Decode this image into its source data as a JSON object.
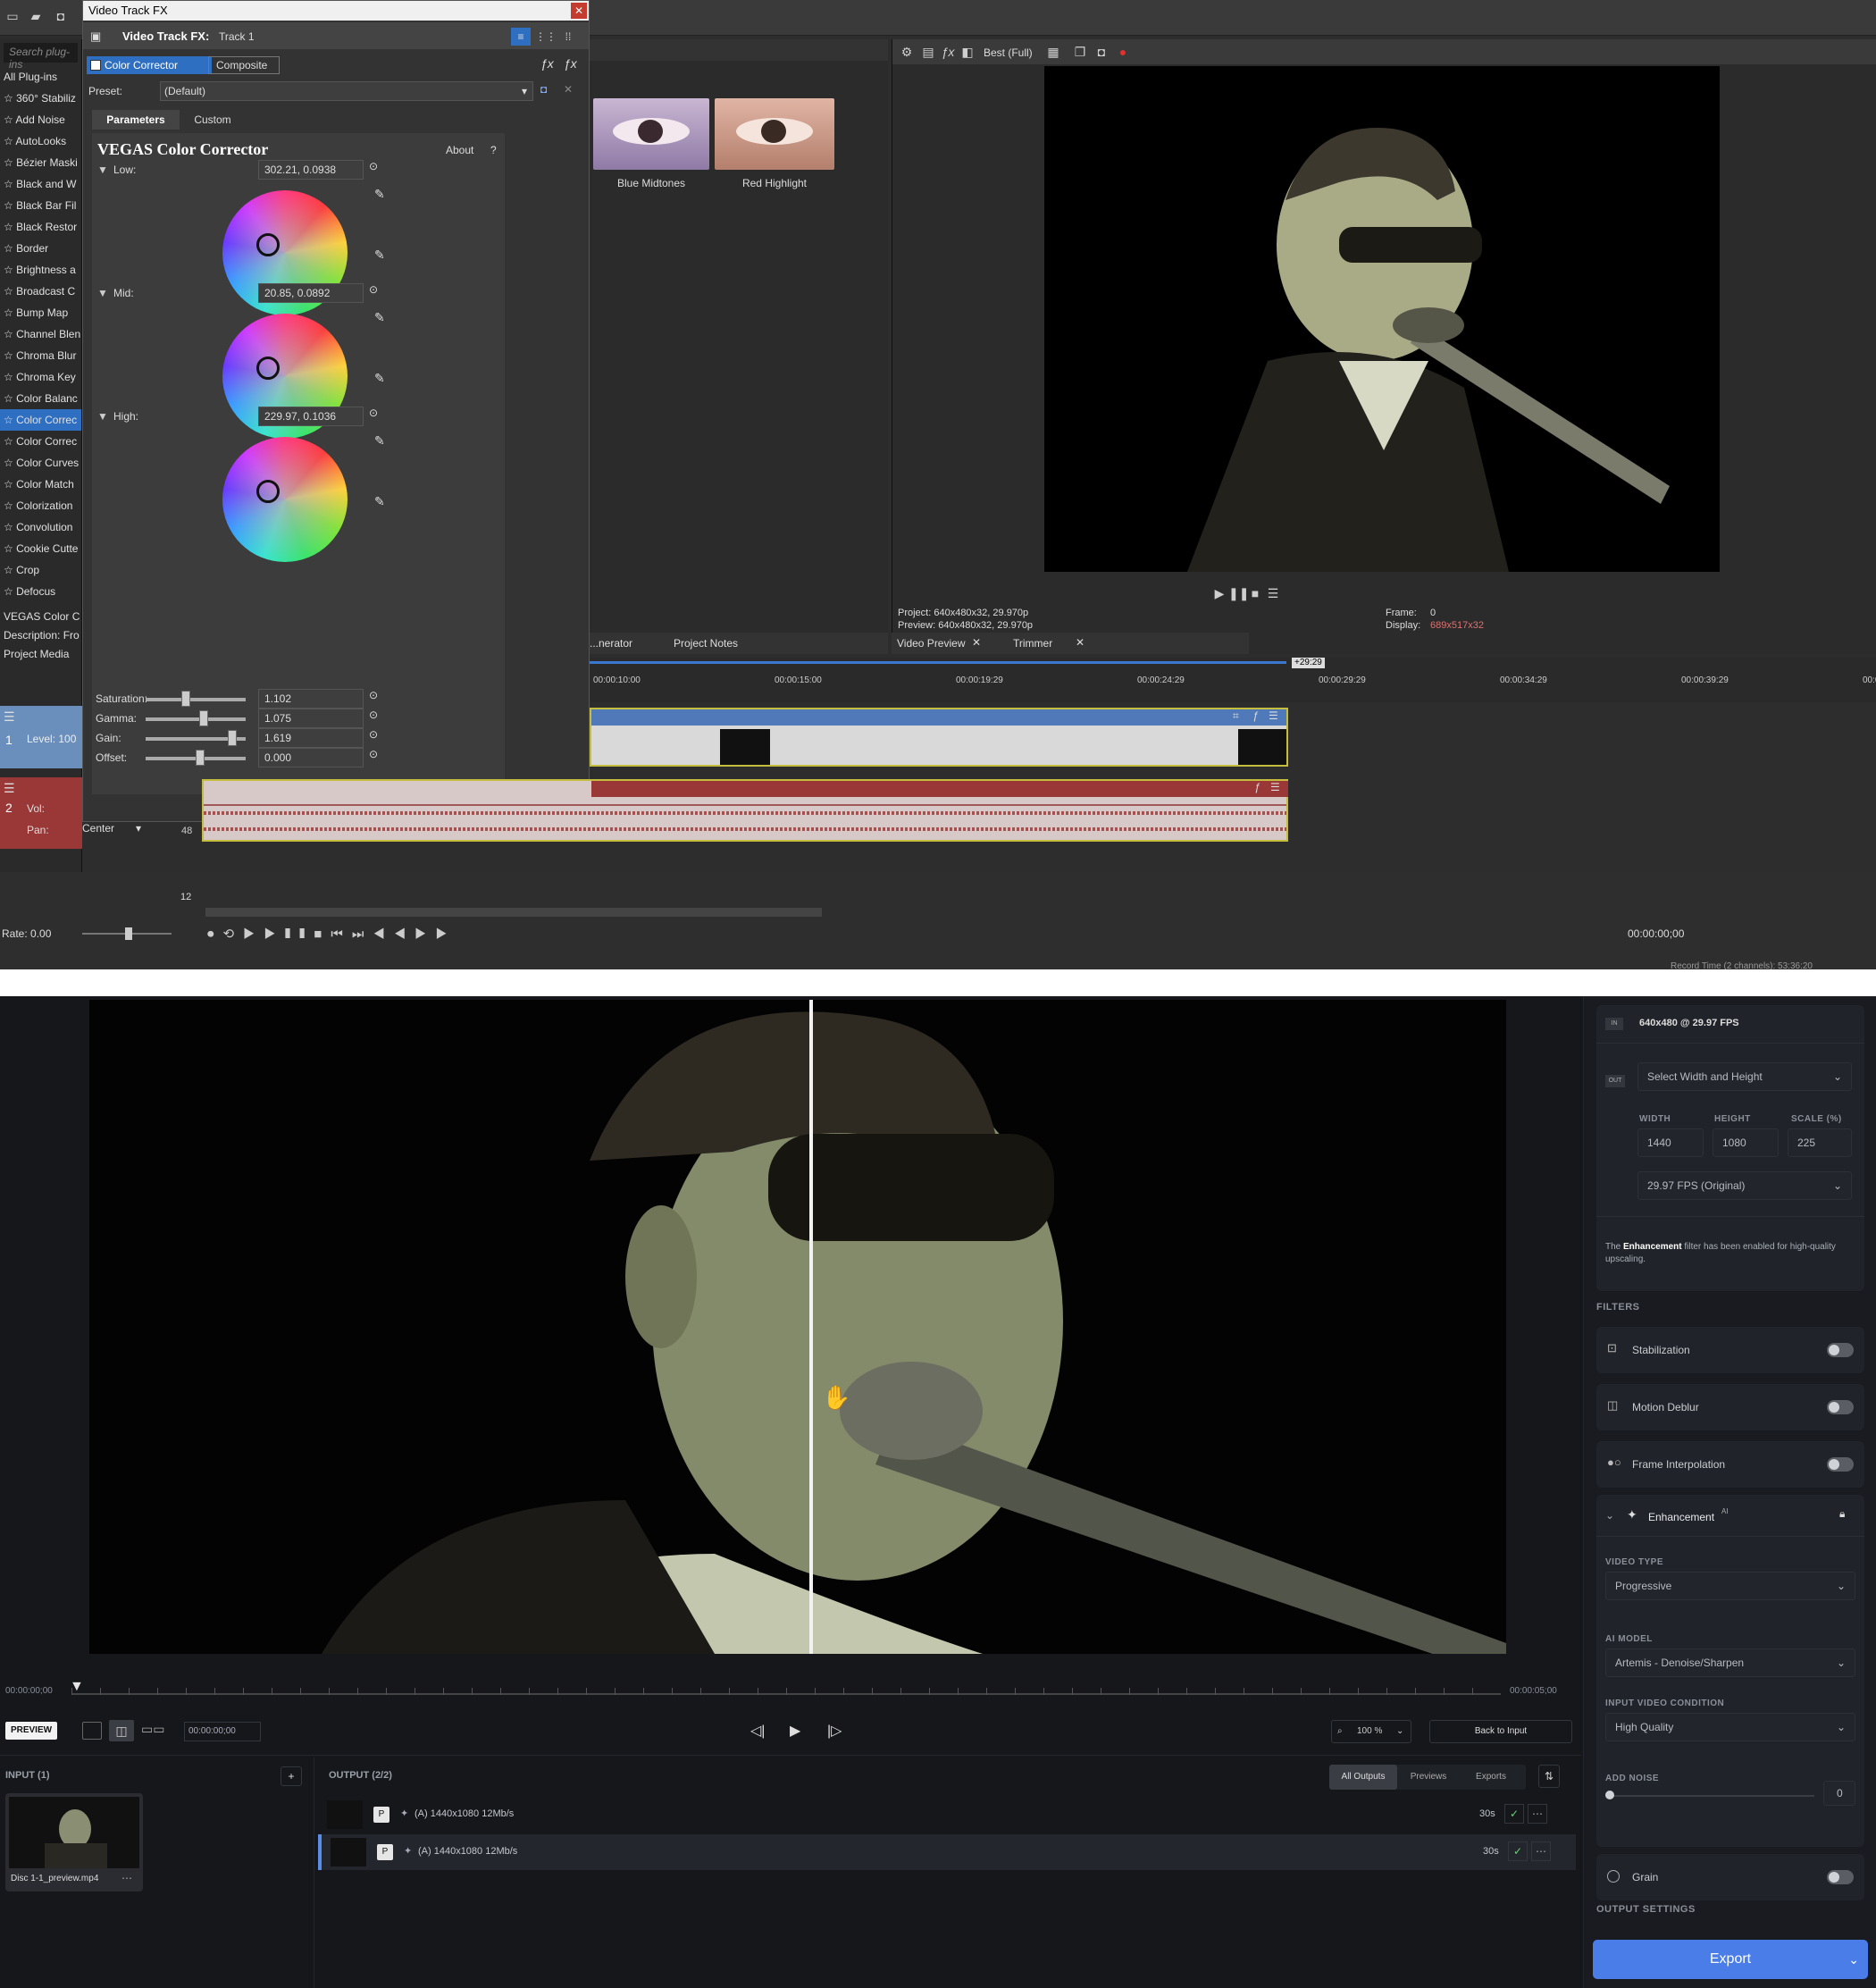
{
  "vegas": {
    "plugin_list": {
      "search_placeholder": "Search plug-ins",
      "items": [
        "All Plug-ins",
        "360° Stabiliz",
        "Add Noise",
        "AutoLooks",
        "Bézier Maski",
        "Black and W",
        "Black Bar Fil",
        "Black Restor",
        "Border",
        "Brightness a",
        "Broadcast C",
        "Bump Map",
        "Channel Blen",
        "Chroma Blur",
        "Chroma Key",
        "Color Balanc",
        "Color Correc",
        "Color Correc",
        "Color Curves",
        "Color Match",
        "Colorization",
        "Convolution",
        "Cookie Cutte",
        "Crop",
        "Defocus"
      ],
      "selected_index": 16,
      "desc_title": "VEGAS Color C",
      "desc_line": "Description: Fro",
      "tab": "Project Media"
    },
    "fx_dialog": {
      "title": "Video Track FX",
      "header": "Video Track FX:",
      "track": "Track 1",
      "chain": [
        "Color Corrector",
        "Composite"
      ],
      "preset_label": "Preset:",
      "preset_value": "(Default)",
      "tabs": [
        "Parameters",
        "Custom"
      ],
      "plugin_name": "VEGAS Color Corrector",
      "about": "About",
      "help": "?",
      "wheels": [
        {
          "label": "Low:",
          "value": "302.21, 0.0938"
        },
        {
          "label": "Mid:",
          "value": "20.85, 0.0892"
        },
        {
          "label": "High:",
          "value": "229.97, 0.1036"
        }
      ],
      "sliders": [
        {
          "label": "Saturation:",
          "value": "1.102",
          "pos": 0.36
        },
        {
          "label": "Gamma:",
          "value": "1.075",
          "pos": 0.54
        },
        {
          "label": "Gain:",
          "value": "1.619",
          "pos": 0.82
        },
        {
          "label": "Offset:",
          "value": "0.000",
          "pos": 0.5
        }
      ]
    },
    "presets": [
      {
        "name": "Blue Midtones"
      },
      {
        "name": "Red Highlight"
      }
    ],
    "preview": {
      "quality": "Best (Full)",
      "project": "Project:  640x480x32, 29.970p",
      "preview": "Preview: 640x480x32, 29.970p",
      "frame_label": "Frame:",
      "frame": "0",
      "display_label": "Display:",
      "display": "689x517x32",
      "tabs": [
        "Video Preview",
        "Trimmer"
      ],
      "left_tabs": [
        "...nerator",
        "Project Notes"
      ]
    },
    "timeline": {
      "ticks": [
        "00:00:10:00",
        "00:00:15:00",
        "00:00:19:29",
        "00:00:24:29",
        "00:00:29:29",
        "00:00:34:29",
        "00:00:39:29",
        "00:00:44:29",
        "00:00:"
      ],
      "end_marker": "+29:29",
      "level": "Level: 100",
      "vol": "Vol:",
      "pan": "Pan:",
      "pan_value": "Center",
      "track_nums": [
        "1",
        "2"
      ],
      "db": "48",
      "rate": "Rate: 0.00",
      "timecode": "00:00:00;00",
      "record": "Record Time (2 channels): 53:36:20",
      "ruler_val": "12"
    }
  },
  "topaz": {
    "timeline": {
      "start": "00:00:00;00",
      "end": "00:00:05;00"
    },
    "bottom": {
      "preview_badge": "PREVIEW",
      "timecode": "00:00:00;00",
      "zoom": "100 %",
      "back": "Back to Input"
    },
    "input": {
      "label": "INPUT (1)",
      "file": "Disc 1-1_preview.mp4"
    },
    "output": {
      "label": "OUTPUT (2/2)",
      "tabs": [
        "All Outputs",
        "Previews",
        "Exports"
      ],
      "rows": [
        {
          "p": "P",
          "spec": "(A)  1440x1080  12Mb/s",
          "dur": "30s"
        },
        {
          "p": "P",
          "spec": "(A)  1440x1080  12Mb/s",
          "dur": "30s"
        }
      ]
    },
    "side": {
      "in_badge": "IN",
      "in_spec": "640x480 @ 29.97 FPS",
      "out_badge": "OUT",
      "size_select": "Select Width and Height",
      "width_label": "WIDTH",
      "height_label": "HEIGHT",
      "scale_label": "SCALE (%)",
      "width": "1440",
      "height": "1080",
      "scale": "225",
      "fps": "29.97 FPS (Original)",
      "note_pre": "The ",
      "note_bold": "Enhancement",
      "note_post": " filter has been enabled for high-quality upscaling.",
      "filters_label": "FILTERS",
      "filters": [
        "Stabilization",
        "Motion Deblur",
        "Frame Interpolation"
      ],
      "ai_sup": "AI",
      "enhancement": "Enhancement",
      "video_type_label": "VIDEO TYPE",
      "video_type": "Progressive",
      "ai_model_label": "AI MODEL",
      "ai_model": "Artemis - Denoise/Sharpen",
      "condition_label": "INPUT VIDEO CONDITION",
      "condition": "High Quality",
      "noise_label": "ADD NOISE",
      "noise": "0",
      "grain": "Grain",
      "output_settings": "OUTPUT SETTINGS",
      "export": "Export"
    }
  },
  "colors": {
    "accent_blue": "#2f6fc1",
    "topaz_export": "#4a7de8",
    "audio_red": "#9a3838",
    "video_blue": "#4f79b8"
  }
}
